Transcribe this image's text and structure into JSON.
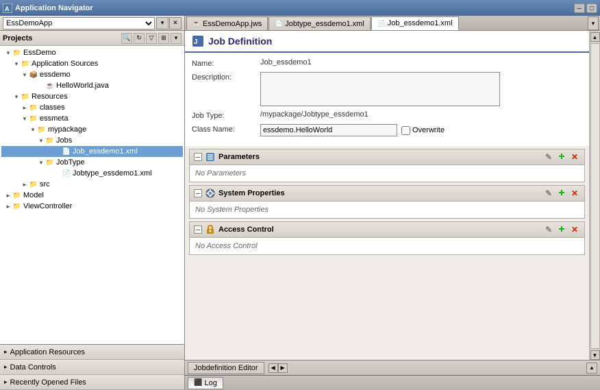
{
  "titlebar": {
    "label": "Application Navigator",
    "min_btn": "─",
    "max_btn": "□",
    "close_btn": "✕"
  },
  "left_panel": {
    "dropdown_value": "EssDemoApp",
    "projects_label": "Projects",
    "tree": [
      {
        "id": "essdemo-root",
        "label": "EssDemo",
        "level": 0,
        "type": "folder",
        "expanded": true,
        "toggle": "▾"
      },
      {
        "id": "app-sources",
        "label": "Application Sources",
        "level": 1,
        "type": "folder",
        "expanded": true,
        "toggle": "▾"
      },
      {
        "id": "essdemo-pkg",
        "label": "essdemo",
        "level": 2,
        "type": "folder",
        "expanded": true,
        "toggle": "▾"
      },
      {
        "id": "helloworld",
        "label": "HelloWorld.java",
        "level": 3,
        "type": "java",
        "expanded": false,
        "toggle": ""
      },
      {
        "id": "resources",
        "label": "Resources",
        "level": 1,
        "type": "folder",
        "expanded": true,
        "toggle": "▾"
      },
      {
        "id": "classes",
        "label": "classes",
        "level": 2,
        "type": "folder",
        "expanded": false,
        "toggle": "▸"
      },
      {
        "id": "essmeta",
        "label": "essmeta",
        "level": 2,
        "type": "folder",
        "expanded": true,
        "toggle": "▾"
      },
      {
        "id": "mypackage",
        "label": "mypackage",
        "level": 3,
        "type": "folder",
        "expanded": true,
        "toggle": "▾"
      },
      {
        "id": "jobs",
        "label": "Jobs",
        "level": 4,
        "type": "folder",
        "expanded": true,
        "toggle": "▾"
      },
      {
        "id": "job-essdemo1",
        "label": "Job_essdemo1.xml",
        "level": 5,
        "type": "xml",
        "expanded": false,
        "toggle": "",
        "selected": true
      },
      {
        "id": "jobtype",
        "label": "JobType",
        "level": 4,
        "type": "folder",
        "expanded": true,
        "toggle": "▾"
      },
      {
        "id": "jobtype-essdemo1",
        "label": "Jobtype_essdemo1.xml",
        "level": 5,
        "type": "xml",
        "expanded": false,
        "toggle": ""
      },
      {
        "id": "src",
        "label": "src",
        "level": 2,
        "type": "folder",
        "expanded": false,
        "toggle": "▸"
      },
      {
        "id": "model",
        "label": "Model",
        "level": 0,
        "type": "folder",
        "expanded": false,
        "toggle": "▸"
      },
      {
        "id": "viewcontroller",
        "label": "ViewController",
        "level": 0,
        "type": "folder",
        "expanded": false,
        "toggle": "▸"
      }
    ],
    "bottom_sections": [
      {
        "id": "app-resources",
        "label": "Application Resources"
      },
      {
        "id": "data-controls",
        "label": "Data Controls"
      },
      {
        "id": "recently-opened",
        "label": "Recently Opened Files"
      }
    ]
  },
  "tabs": [
    {
      "id": "essdemoapp-jws",
      "label": "EssDemoApp.jws",
      "active": false,
      "icon": "☕"
    },
    {
      "id": "jobtype-essdemo1-xml",
      "label": "Jobtype_essdemo1.xml",
      "active": false,
      "icon": "📄"
    },
    {
      "id": "job-essdemo1-xml",
      "label": "Job_essdemo1.xml",
      "active": true,
      "icon": "📄"
    }
  ],
  "form": {
    "title": "Job Definition",
    "fields": {
      "name_label": "Name:",
      "name_value": "Job_essdemo1",
      "description_label": "Description:",
      "description_value": "",
      "job_type_label": "Job Type:",
      "job_type_value": "/mypackage/Jobtype_essdemo1",
      "class_name_label": "Class Name:",
      "class_name_value": "essdemo.HelloWorld",
      "overwrite_label": "Overwrite"
    },
    "sections": [
      {
        "id": "parameters",
        "title": "Parameters",
        "icon": "⊞",
        "expanded": true,
        "empty_text": "No Parameters"
      },
      {
        "id": "system-properties",
        "title": "System Properties",
        "icon": "⚙",
        "expanded": true,
        "empty_text": "No System Properties"
      },
      {
        "id": "access-control",
        "title": "Access Control",
        "icon": "🔑",
        "expanded": true,
        "empty_text": "No Access Control"
      }
    ],
    "section_btns": {
      "edit": "✎",
      "add": "+",
      "remove": "✕"
    }
  },
  "status_bar": {
    "editor_label": "Jobdefinition Editor",
    "log_label": "Log"
  }
}
